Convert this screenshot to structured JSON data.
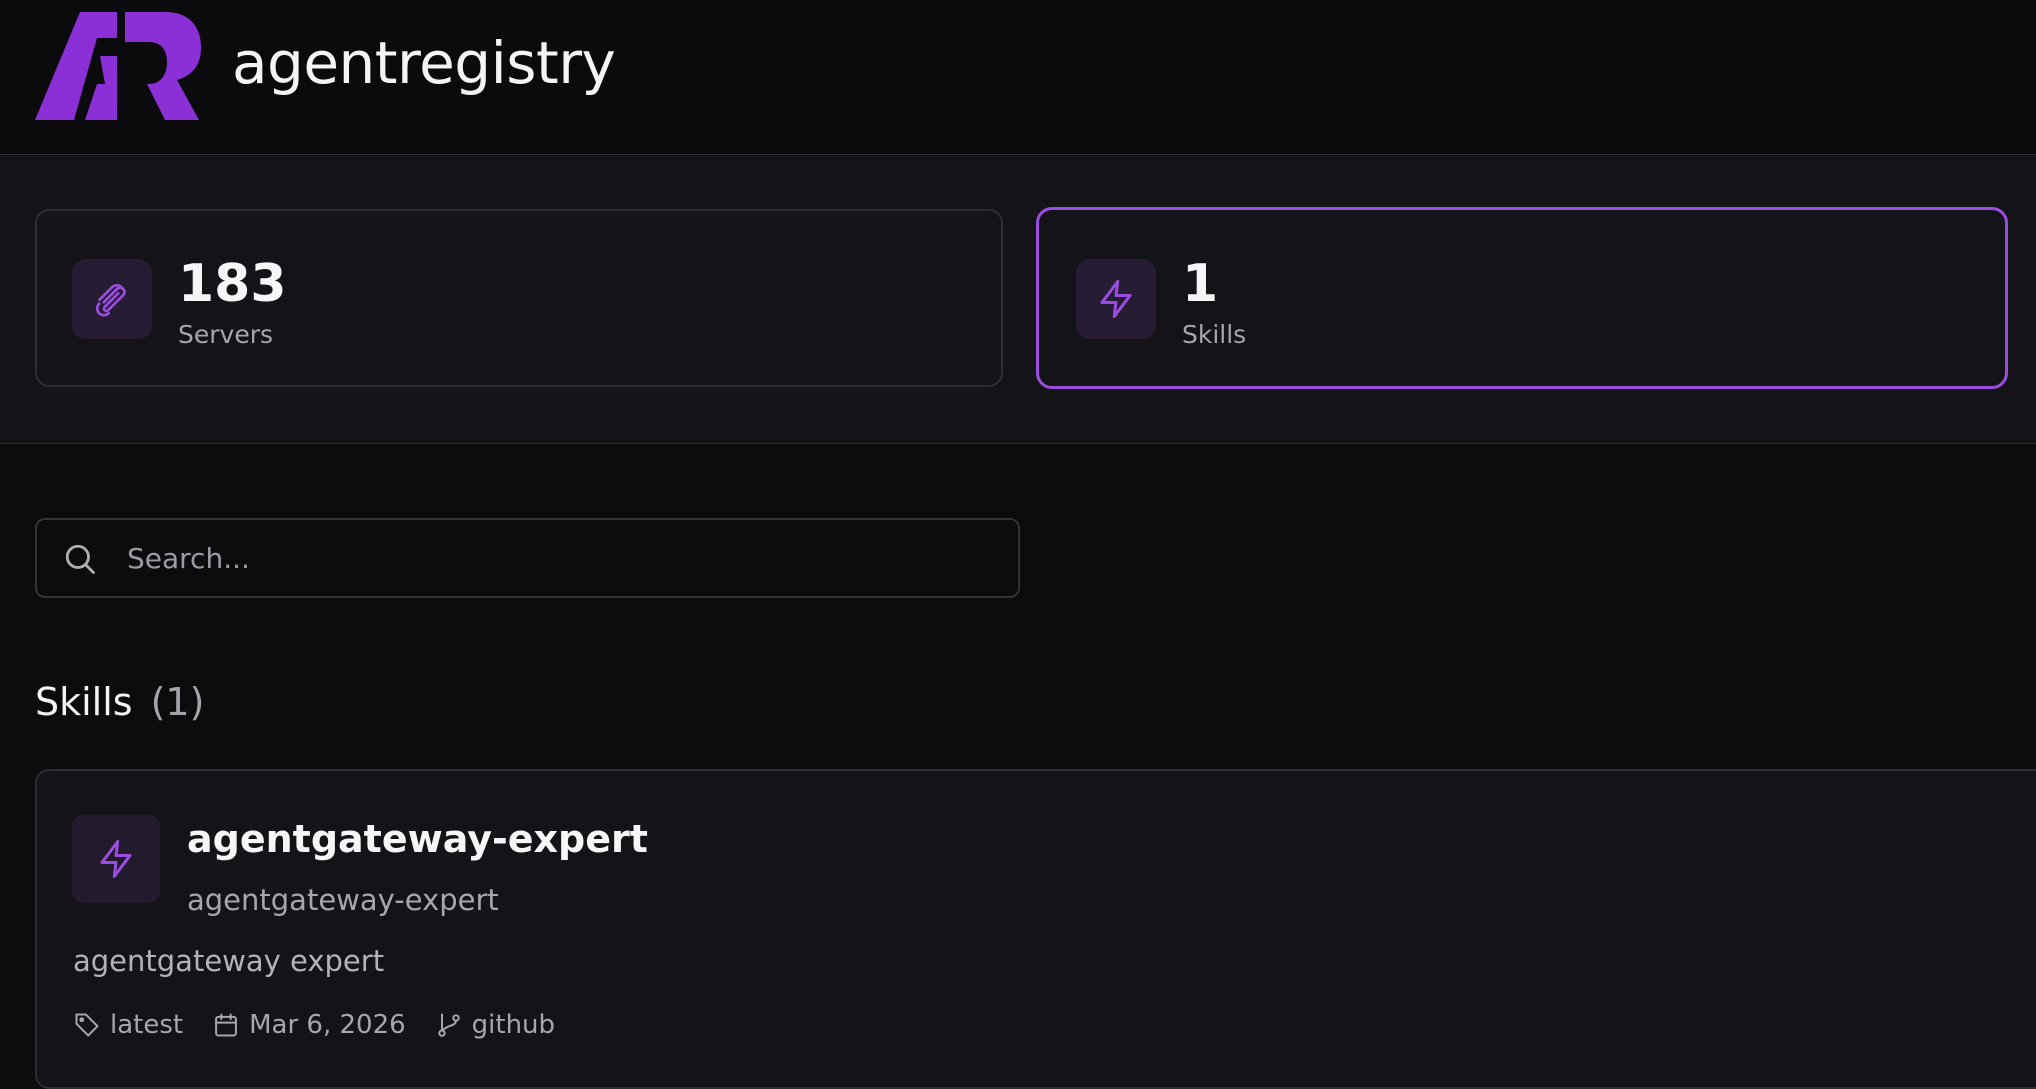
{
  "header": {
    "brand": "agentregistry",
    "logo_icon": "ar-logo-icon",
    "accent_color": "#8b2fd6"
  },
  "stats": {
    "servers": {
      "count": "183",
      "label": "Servers",
      "icon": "paperclip-icon"
    },
    "skills": {
      "count": "1",
      "label": "Skills",
      "icon": "lightning-icon",
      "selected": true
    }
  },
  "search": {
    "placeholder": "Search...",
    "value": ""
  },
  "section": {
    "title": "Skills",
    "count": "(1)"
  },
  "skills_list": [
    {
      "name": "agentgateway-expert",
      "subtitle": "agentgateway-expert",
      "description": "agentgateway expert",
      "version": "latest",
      "date": "Mar 6, 2026",
      "source": "github",
      "icon": "lightning-icon"
    }
  ],
  "colors": {
    "background": "#0c0b0e",
    "panel": "#141318",
    "selected_border": "#9a4de0",
    "icon_tile": "#261c33"
  }
}
